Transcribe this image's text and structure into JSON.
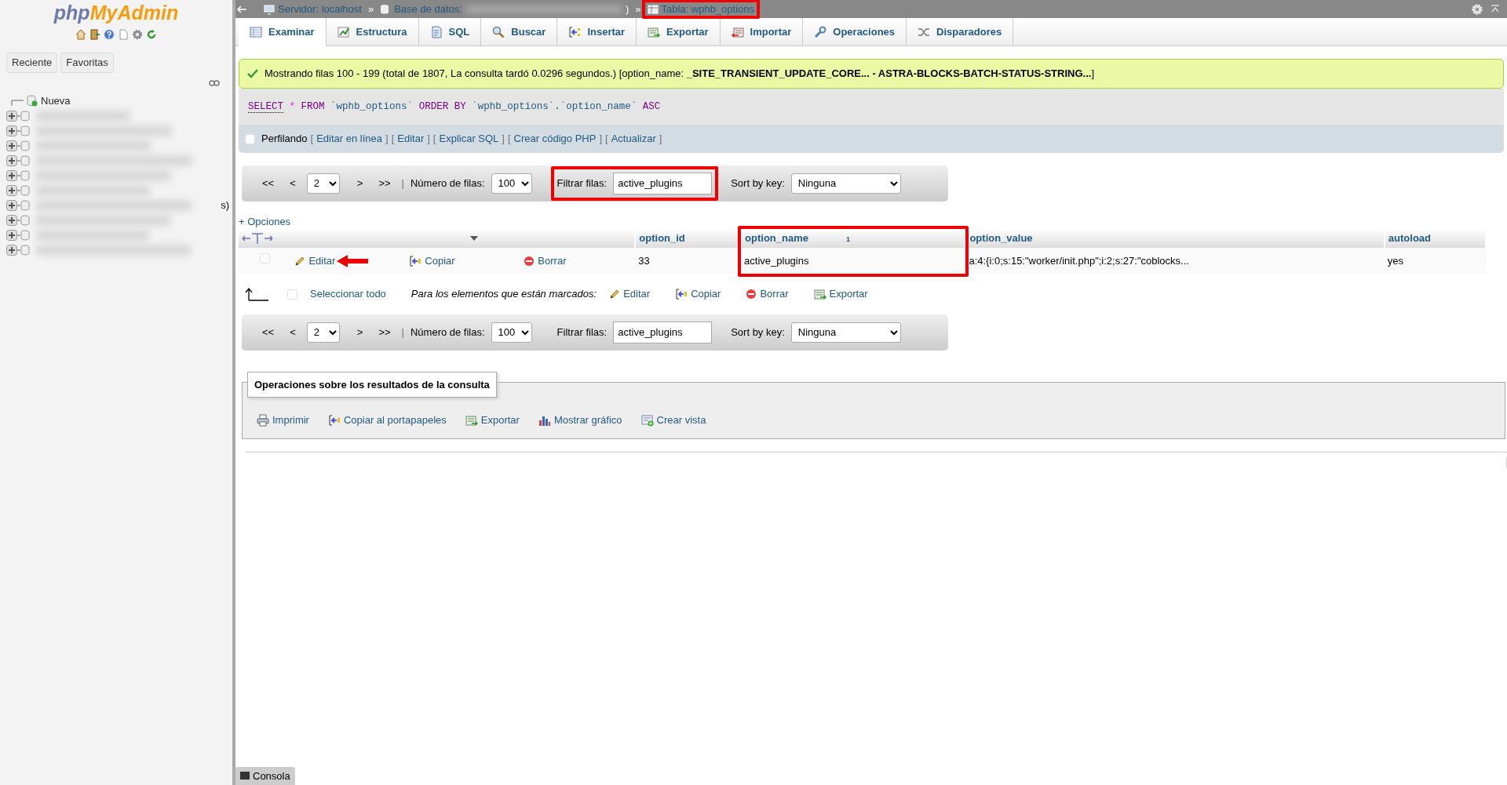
{
  "sidebar": {
    "logo": {
      "part_1": "php",
      "part_2": "MyAdmin"
    },
    "buttons": [
      {
        "label": "Reciente"
      },
      {
        "label": "Favoritas"
      }
    ],
    "new_item": "Nueva",
    "clipped_text": "s)"
  },
  "breadcrumb": [
    {
      "kind": "server",
      "label": "Servidor: localhost",
      "separator": "»"
    },
    {
      "kind": "database",
      "label": "Base de datos:",
      "suffix": ")",
      "separator": "»"
    },
    {
      "kind": "table",
      "label": "Tabla: wphb_options",
      "highlighted": true
    }
  ],
  "tabs": [
    {
      "kind": "browse",
      "label": "Examinar",
      "selected": true
    },
    {
      "kind": "structure",
      "label": "Estructura",
      "selected": false
    },
    {
      "kind": "sql",
      "label": "SQL",
      "selected": false
    },
    {
      "kind": "search",
      "label": "Buscar",
      "selected": false
    },
    {
      "kind": "insert",
      "label": "Insertar",
      "selected": false
    },
    {
      "kind": "export",
      "label": "Exportar",
      "selected": false
    },
    {
      "kind": "import",
      "label": "Importar",
      "selected": false
    },
    {
      "kind": "operations",
      "label": "Operaciones",
      "selected": false
    },
    {
      "kind": "triggers",
      "label": "Disparadores",
      "selected": false
    }
  ],
  "message": "Mostrando filas 100 - 199 (total de 1807, La consulta tardó 0.0296 segundos.) [option_name: **_SITE_TRANSIENT_UPDATE_CORE... - ASTRA-BLOCKS-BATCH-STATUS-STRING...**]",
  "sql": [
    {
      "kind": "keyword",
      "text": "SELECT"
    },
    {
      "kind": "operator",
      "text": "*"
    },
    {
      "kind": "keyword",
      "text": "FROM"
    },
    {
      "kind": "identifier",
      "text": "`wphb_options`"
    },
    {
      "kind": "keyword",
      "text": "ORDER BY"
    },
    {
      "kind": "identifier",
      "text": "`wphb_options`.`option_name`"
    },
    {
      "kind": "keyword",
      "text": "ASC"
    }
  ],
  "profiling": {
    "label": "Perfilando",
    "checked": false,
    "bracket_open": "[",
    "bracket_close": "]",
    "links": [
      "Editar en línea",
      "Editar",
      "Explicar SQL",
      "Crear código PHP",
      "Actualizar"
    ]
  },
  "navigation_bars": [
    {
      "first": "<<",
      "prev": "<",
      "page": "2",
      "next": ">",
      "last": ">>",
      "separator": "|",
      "rows_label": "Número de filas:",
      "rows_value": "100",
      "filter_label": "Filtrar filas:",
      "filter_value": "active_plugins",
      "filter_highlighted": true,
      "sort_label": "Sort by key:",
      "sort_value": "Ninguna"
    },
    {
      "first": "<<",
      "prev": "<",
      "page": "2",
      "next": ">",
      "last": ">>",
      "separator": "|",
      "rows_label": "Número de filas:",
      "rows_value": "100",
      "filter_label": "Filtrar filas:",
      "filter_value": "active_plugins",
      "filter_highlighted": false,
      "sort_label": "Sort by key:",
      "sort_value": "Ninguna"
    }
  ],
  "options_link": "+ Opciones",
  "table": {
    "columns": [
      {
        "label": "option_id",
        "highlighted": false
      },
      {
        "label": "option_name",
        "sort_indicator": "1",
        "highlighted": true
      },
      {
        "label": "option_value",
        "highlighted": false
      },
      {
        "label": "autoload",
        "highlighted": false
      }
    ],
    "rows": [
      {
        "checked": false,
        "actions": [
          {
            "kind": "edit",
            "label": "Editar",
            "pointed": true
          },
          {
            "kind": "copy",
            "label": "Copiar",
            "pointed": false
          },
          {
            "kind": "delete",
            "label": "Borrar",
            "pointed": false
          }
        ],
        "cells": [
          "33",
          "active_plugins",
          "a:4:{i:0;s:15:\"worker/init.php\";i:2;s:27:\"coblocks...",
          "yes"
        ]
      }
    ]
  },
  "bulk": {
    "checked": false,
    "select_all": "Seleccionar todo",
    "marked_label": "Para los elementos que están marcados:",
    "actions": [
      {
        "kind": "edit",
        "label": "Editar"
      },
      {
        "kind": "copy",
        "label": "Copiar"
      },
      {
        "kind": "delete",
        "label": "Borrar"
      },
      {
        "kind": "export",
        "label": "Exportar"
      }
    ]
  },
  "query_operations": {
    "legend": "Operaciones sobre los resultados de la consulta",
    "actions": [
      {
        "kind": "print",
        "label": "Imprimir"
      },
      {
        "kind": "copy",
        "label": "Copiar al portapapeles"
      },
      {
        "kind": "export",
        "label": "Exportar"
      },
      {
        "kind": "chart",
        "label": "Mostrar gráfico"
      },
      {
        "kind": "view",
        "label": "Crear vista"
      }
    ]
  },
  "console": {
    "label": "Consola"
  }
}
